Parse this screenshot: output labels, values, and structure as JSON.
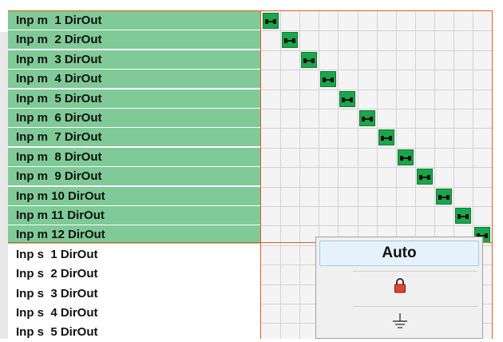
{
  "rows_master": [
    "Inp m  1 DirOut",
    "Inp m  2 DirOut",
    "Inp m  3 DirOut",
    "Inp m  4 DirOut",
    "Inp m  5 DirOut",
    "Inp m  6 DirOut",
    "Inp m  7 DirOut",
    "Inp m  8 DirOut",
    "Inp m  9 DirOut",
    "Inp m 10 DirOut",
    "Inp m 11 DirOut",
    "Inp m 12 DirOut"
  ],
  "rows_slave": [
    "Inp s  1 DirOut",
    "Inp s  2 DirOut",
    "Inp s  3 DirOut",
    "Inp s  4 DirOut",
    "Inp s  5 DirOut"
  ],
  "context_menu": {
    "auto_label": "Auto",
    "items": [
      "lock-icon",
      "ground-icon"
    ]
  },
  "colors": {
    "row_highlight": "#7fca97",
    "cell_active": "#1aa64a",
    "border_accent": "#e06020"
  }
}
